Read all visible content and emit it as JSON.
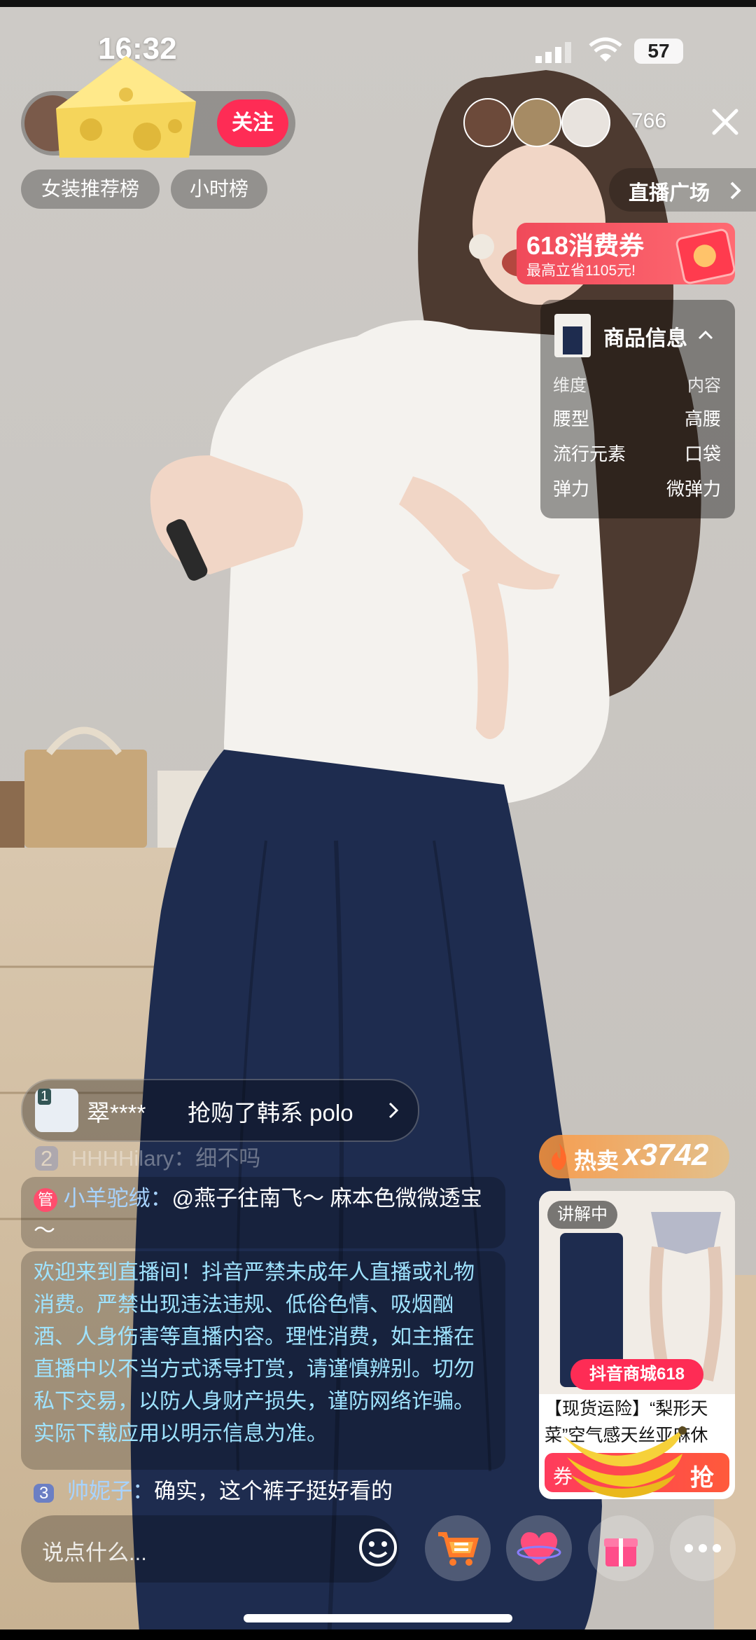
{
  "status_bar": {
    "time": "16:32",
    "battery": "57"
  },
  "host": {
    "follow_label": "关注"
  },
  "viewers": {
    "count": "766"
  },
  "tags": [
    "女装推荐榜",
    "小时榜"
  ],
  "plaza": {
    "label": "直播广场"
  },
  "coupon": {
    "title": "618消费券",
    "subtitle": "最高立省1105元!"
  },
  "product_info": {
    "title": "商品信息",
    "header": {
      "left": "维度",
      "right": "内容"
    },
    "rows": [
      {
        "left": "腰型",
        "right": "高腰"
      },
      {
        "left": "流行元素",
        "right": "口袋"
      },
      {
        "left": "弹力",
        "right": "微弹力"
      }
    ]
  },
  "purchase_toast": {
    "rank": "1",
    "text": "翠****",
    "action": "抢购了韩系 polo"
  },
  "chat": {
    "faded_line": "HHHHilary：细不吗",
    "faded_level": "2",
    "msg1": {
      "badge": "管",
      "user": "小羊驼绒：",
      "text": "@燕子往南飞～ 麻本色微微透宝～"
    },
    "notice": "欢迎来到直播间！抖音严禁未成年人直播或礼物消费。严禁出现违法违规、低俗色情、吸烟酗酒、人身伤害等直播内容。理性消费，如主播在直播中以不当方式诱导打赏，请谨慎辨别。切勿私下交易，以防人身财产损失，谨防网络诈骗。实际下载应用以明示信息为准。",
    "msg2": {
      "level": "3",
      "user": "帅妮子：",
      "text": "确实，这个裤子挺好看的"
    }
  },
  "hot_sale": {
    "label": "热卖",
    "count": "x3742"
  },
  "product_card": {
    "live_label": "讲解中",
    "mall_badge": "抖音商城618",
    "title": "【现货运险】“梨形天菜”空气感天丝亚麻休闲...",
    "buy_label": "抢",
    "price_prefix": "券"
  },
  "bottom_bar": {
    "placeholder": "说点什么..."
  },
  "colors": {
    "accent": "#FE2C55",
    "gold": "#FFD36A",
    "pants": "#1E2C4F"
  },
  "icons": [
    "cheese-sticker",
    "banana-sticker",
    "close-icon",
    "chevron-right-icon",
    "smiley-icon",
    "cart-icon",
    "heart-icon",
    "gift-icon",
    "more-icon"
  ]
}
